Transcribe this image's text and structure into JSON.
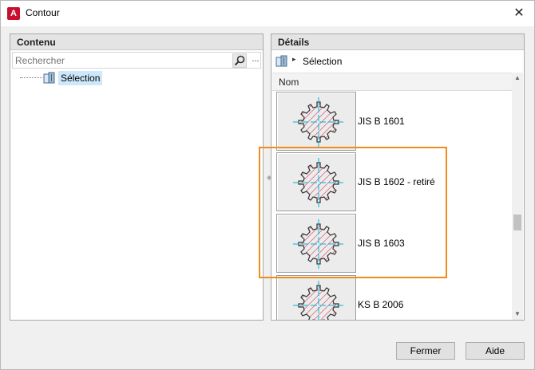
{
  "window": {
    "title": "Contour",
    "app_icon_letter": "A",
    "close_glyph": "✕"
  },
  "left_panel": {
    "header": "Contenu",
    "search": {
      "placeholder": "Rechercher",
      "value": ""
    },
    "more_label": "...",
    "tree": [
      {
        "label": "Sélection",
        "icon": "folder-block-icon",
        "selected": true
      }
    ]
  },
  "right_panel": {
    "header": "Détails",
    "breadcrumb": {
      "icon": "folder-block-icon",
      "separator": "▸",
      "label": "Sélection"
    },
    "column_header": "Nom",
    "items": [
      {
        "label": "JIS B 1601",
        "icon": "spline-shaft-profile-icon"
      },
      {
        "label": "JIS B 1602 - retiré",
        "icon": "spline-shaft-profile-icon"
      },
      {
        "label": "JIS B 1603",
        "icon": "spline-shaft-profile-icon"
      },
      {
        "label": "KS B 2006",
        "icon": "spline-shaft-profile-icon"
      }
    ]
  },
  "footer": {
    "close_label": "Fermer",
    "help_label": "Aide"
  },
  "colors": {
    "highlight": "#f08c1e",
    "selection": "#cde8fb",
    "hatch": "#c8102e",
    "centerline": "#00b4d8"
  }
}
